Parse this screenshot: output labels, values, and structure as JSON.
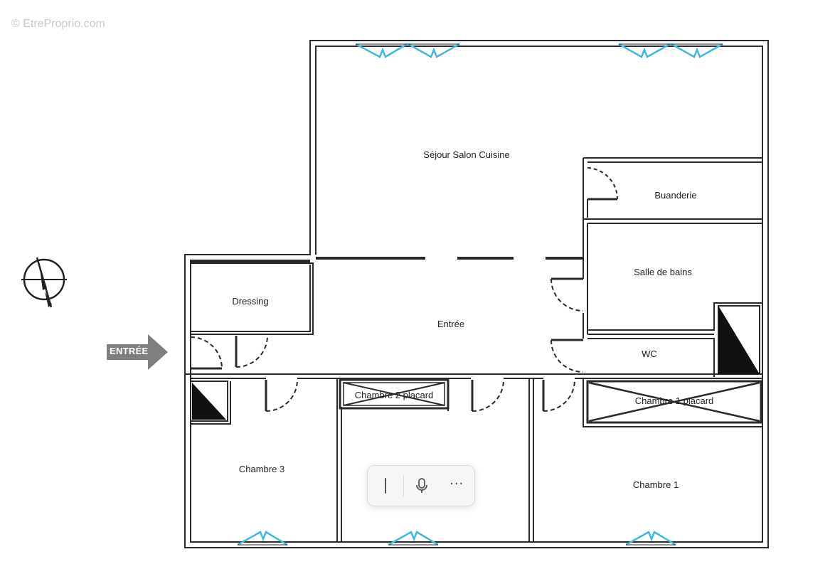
{
  "watermark": "© EtreProprio.com",
  "entrance_label": "ENTRÉE",
  "rooms": {
    "sejour": "Séjour  Salon Cuisine",
    "buanderie": "Buanderie",
    "salle_de_bains": "Salle de bains",
    "dressing": "Dressing",
    "entree": "Entrée",
    "wc": "WC",
    "chambre2_placard": "Chambre 2 placard",
    "chambre1_placard": "Chambre 1 placard",
    "chambre3": "Chambre 3",
    "chambre1": "Chambre 1"
  },
  "toolbar": {
    "items": [
      "text-cursor-icon",
      "microphone-icon",
      "more-icon"
    ],
    "more_label": "···"
  },
  "colors": {
    "wall": "#2a2a2a",
    "window": "#3fb6e3",
    "arrow": "#7f7f7f"
  }
}
